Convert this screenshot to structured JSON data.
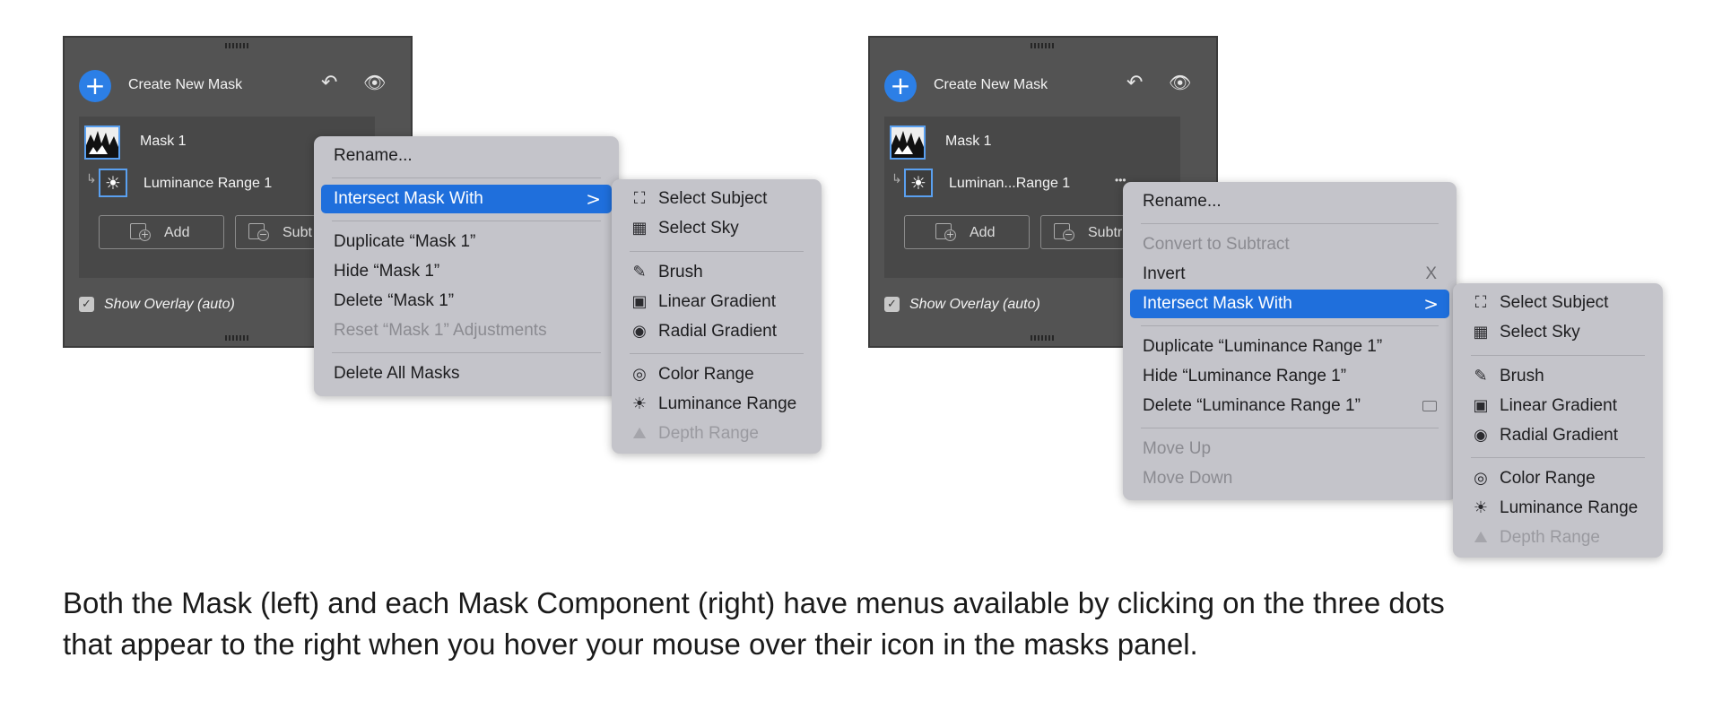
{
  "left_panel": {
    "create_label": "Create New Mask",
    "plus": "+",
    "mask_label": "Mask 1",
    "component_label": "Luminance Range 1",
    "add_label": "Add",
    "subtract_label": "Subt",
    "show_overlay": "Show Overlay (auto)",
    "checked": "✓"
  },
  "left_menu": {
    "rename": "Rename...",
    "intersect": "Intersect Mask With",
    "chevron": ">",
    "duplicate": "Duplicate “Mask 1”",
    "hide": "Hide “Mask 1”",
    "delete": "Delete “Mask 1”",
    "reset": "Reset “Mask 1” Adjustments",
    "delete_all": "Delete All Masks"
  },
  "right_panel": {
    "create_label": "Create New Mask",
    "plus": "+",
    "mask_label": "Mask 1",
    "component_label": "Luminan...Range 1",
    "dots": "•••",
    "add_label": "Add",
    "subtract_label": "Subtr",
    "show_overlay": "Show Overlay (auto)",
    "checked": "✓"
  },
  "right_menu": {
    "rename": "Rename...",
    "convert": "Convert to Subtract",
    "invert": "Invert",
    "invert_shortcut": "X",
    "intersect": "Intersect Mask With",
    "chevron": ">",
    "duplicate": "Duplicate “Luminance Range 1”",
    "hide": "Hide “Luminance Range 1”",
    "delete": "Delete “Luminance Range 1”",
    "move_up": "Move Up",
    "move_down": "Move Down"
  },
  "submenu_items": {
    "select_subject": "Select Subject",
    "select_sky": "Select Sky",
    "brush": "Brush",
    "linear_gradient": "Linear Gradient",
    "radial_gradient": "Radial Gradient",
    "color_range": "Color Range",
    "luminance_range": "Luminance Range",
    "depth_range": "Depth Range"
  },
  "caption": {
    "line1": "Both the Mask (left) and each Mask Component (right) have menus available by clicking on the three dots",
    "line2": "that appear to the right when you hover your mouse over their icon in the masks panel."
  },
  "colors": {
    "panel_bg": "#535353",
    "accent_blue": "#1f6fdc",
    "menu_bg": "#c4c4ca"
  }
}
